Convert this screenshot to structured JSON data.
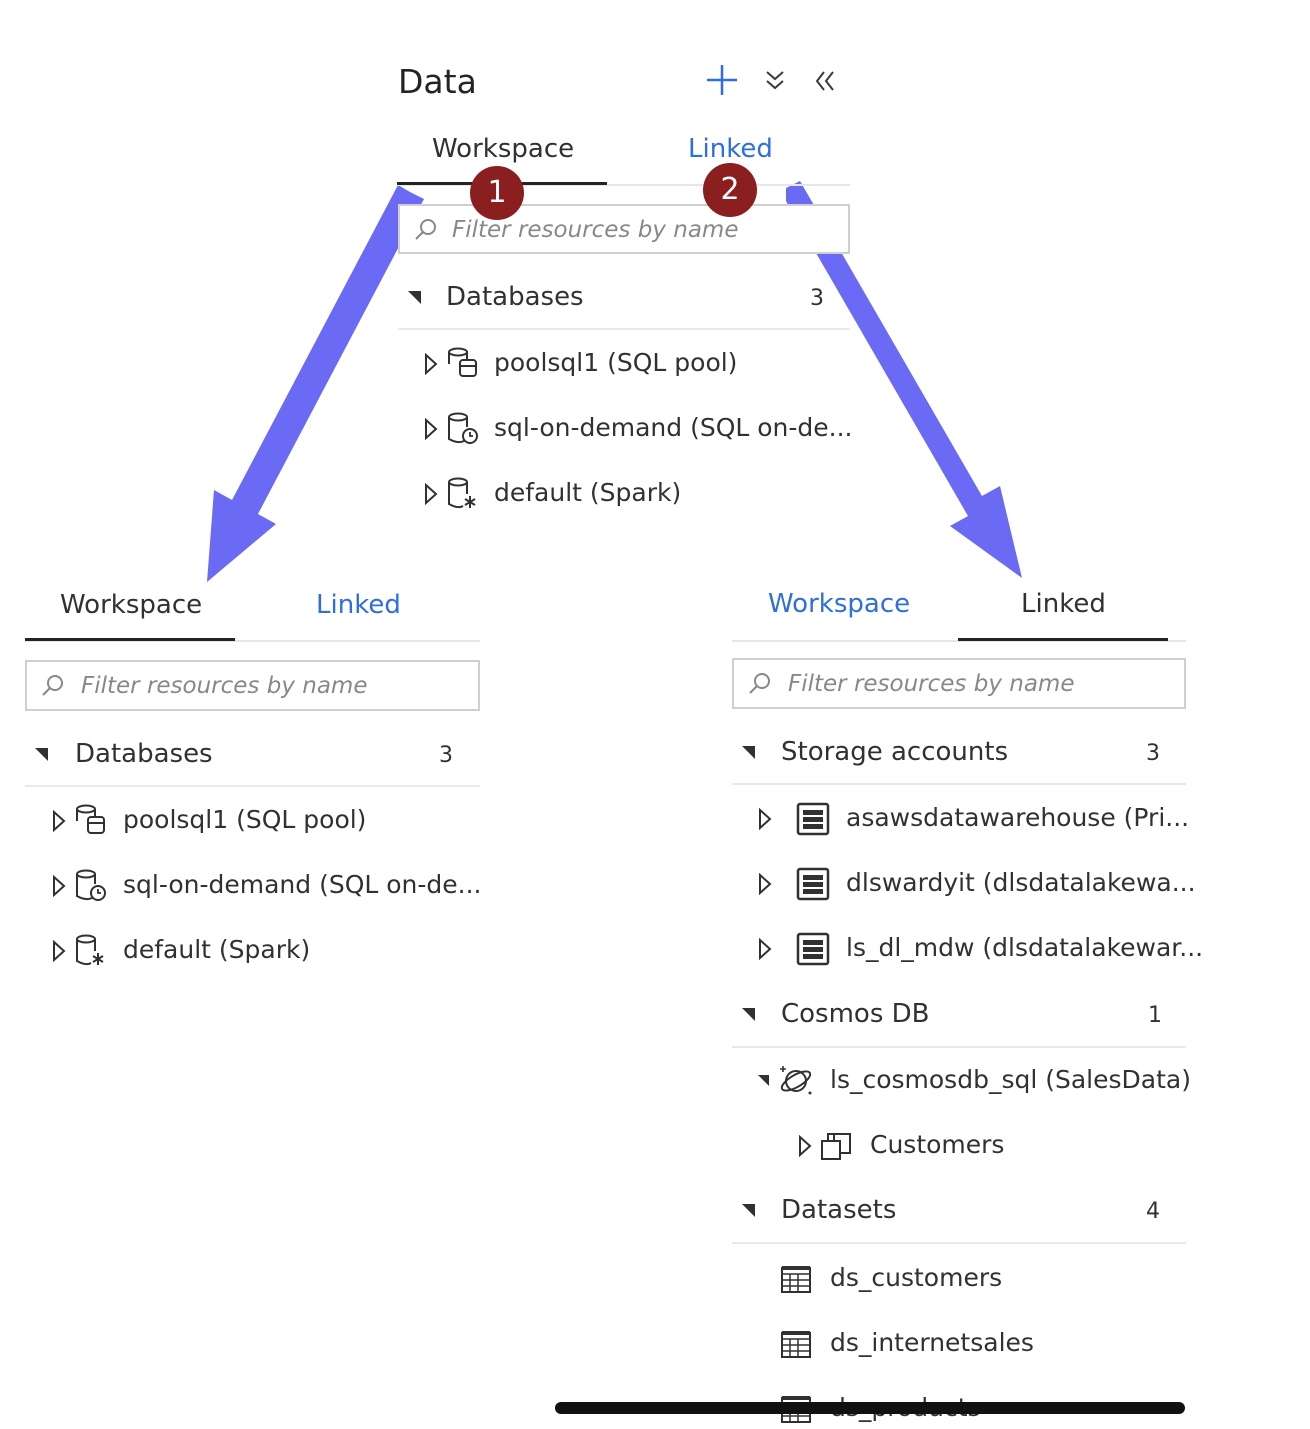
{
  "header": {
    "title": "Data",
    "icons": {
      "add": "plus-icon",
      "expand": "double-chevron-down-icon",
      "collapse": "double-chevron-left-icon"
    }
  },
  "tabs": {
    "workspace": "Workspace",
    "linked": "Linked"
  },
  "filter_placeholder": "Filter resources by name",
  "badges": [
    "1",
    "2"
  ],
  "top_panel": {
    "group": {
      "label": "Databases",
      "count": "3"
    },
    "items": [
      "poolsql1 (SQL pool)",
      "sql-on-demand (SQL on-de...",
      "default (Spark)"
    ]
  },
  "left_panel": {
    "group": {
      "label": "Databases",
      "count": "3"
    },
    "items": [
      "poolsql1 (SQL pool)",
      "sql-on-demand (SQL on-de...",
      "default (Spark)"
    ]
  },
  "right_panel": {
    "storage": {
      "label": "Storage accounts",
      "count": "3",
      "items": [
        "asawsdatawarehouse (Pri...",
        "dlswardyit (dlsdatalakewa...",
        "ls_dl_mdw (dlsdatalakewar..."
      ]
    },
    "cosmos": {
      "label": "Cosmos DB",
      "count": "1",
      "item": "ls_cosmosdb_sql (SalesData)",
      "child": "Customers"
    },
    "datasets": {
      "label": "Datasets",
      "count": "4",
      "items": [
        "ds_customers",
        "ds_internetsales",
        "ds_products"
      ]
    }
  },
  "colors": {
    "accent_link": "#2f6ee0",
    "arrow": "#6a6af5",
    "badge": "#8b1f1f"
  }
}
